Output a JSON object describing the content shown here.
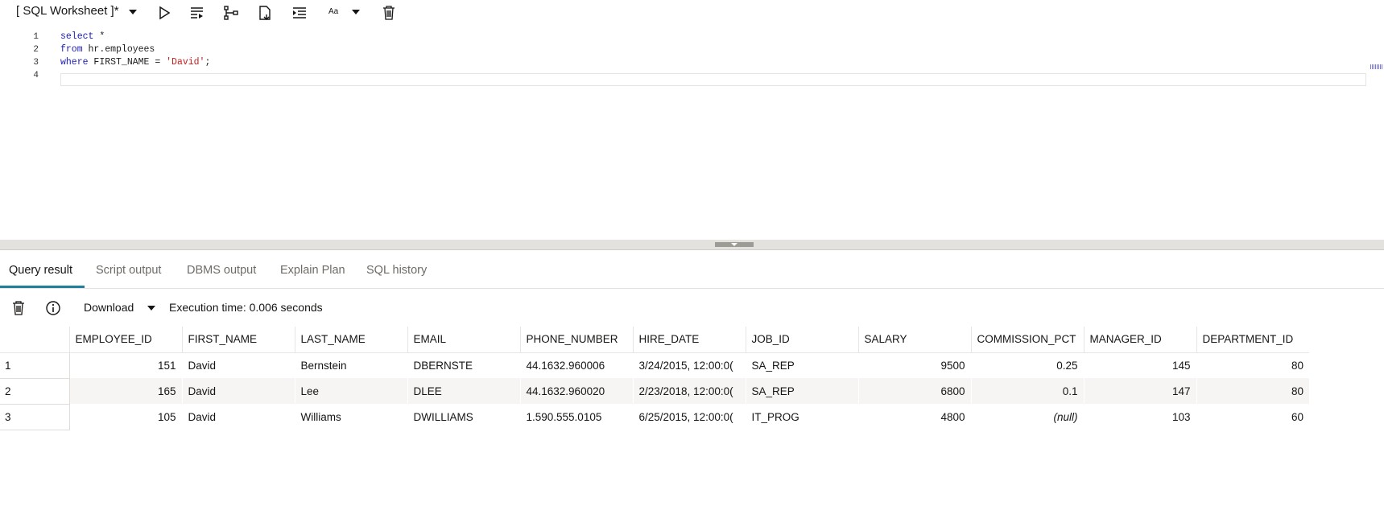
{
  "toolbar": {
    "title": "[ SQL Worksheet ]*",
    "font_size_label": "Aa",
    "icons": [
      "run-icon",
      "run-script-icon",
      "explain-plan-icon",
      "autotrace-icon",
      "format-icon",
      "font-size-icon",
      "clear-icon"
    ]
  },
  "editor": {
    "lines": [
      {
        "num": "1",
        "tokens": [
          {
            "t": "select",
            "k": "kw"
          },
          {
            "t": " *",
            "k": ""
          }
        ]
      },
      {
        "num": "2",
        "tokens": [
          {
            "t": "from",
            "k": "kw"
          },
          {
            "t": " hr.employees",
            "k": ""
          }
        ]
      },
      {
        "num": "3",
        "tokens": [
          {
            "t": "where",
            "k": "kw"
          },
          {
            "t": " FIRST_NAME = ",
            "k": ""
          },
          {
            "t": "'David'",
            "k": "str"
          },
          {
            "t": ";",
            "k": ""
          }
        ]
      },
      {
        "num": "4",
        "tokens": []
      }
    ]
  },
  "results": {
    "tabs": [
      "Query result",
      "Script output",
      "DBMS output",
      "Explain Plan",
      "SQL history"
    ],
    "active_tab": "Query result",
    "download_label": "Download",
    "execution_time": "Execution time: 0.006 seconds",
    "columns": [
      "EMPLOYEE_ID",
      "FIRST_NAME",
      "LAST_NAME",
      "EMAIL",
      "PHONE_NUMBER",
      "HIRE_DATE",
      "JOB_ID",
      "SALARY",
      "COMMISSION_PCT",
      "MANAGER_ID",
      "DEPARTMENT_ID"
    ],
    "rows": [
      {
        "n": "1",
        "cells": [
          "151",
          "David",
          "Bernstein",
          "DBERNSTE",
          "44.1632.960006",
          "3/24/2015, 12:00:0(",
          "SA_REP",
          "9500",
          "0.25",
          "145",
          "80"
        ]
      },
      {
        "n": "2",
        "cells": [
          "165",
          "David",
          "Lee",
          "DLEE",
          "44.1632.960020",
          "2/23/2018, 12:00:0(",
          "SA_REP",
          "6800",
          "0.1",
          "147",
          "80"
        ]
      },
      {
        "n": "3",
        "cells": [
          "105",
          "David",
          "Williams",
          "DWILLIAMS",
          "1.590.555.0105",
          "6/25/2015, 12:00:0(",
          "IT_PROG",
          "4800",
          "(null)",
          "103",
          "60"
        ]
      }
    ]
  },
  "colors": {
    "accent": "#227e9e",
    "keyword": "#1d1db8",
    "string": "#c62020"
  }
}
